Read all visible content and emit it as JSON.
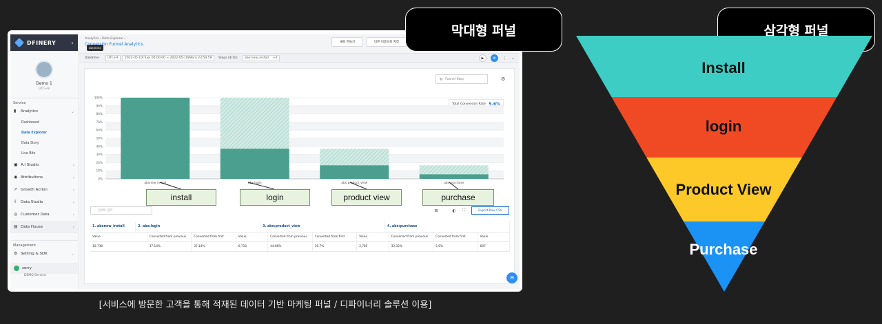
{
  "left_pill": "막대형 퍼널",
  "right_pill": "삼각형 퍼널",
  "caption": "[서비스에 방문한 고객을 통해 적재된 데이터 기반 마케팅 퍼널 / 디파이너리 솔루션 이용]",
  "app": {
    "brand": "DFINERY",
    "user_name": "Demo 1",
    "user_sub": "UTC+9",
    "sidebar": {
      "service_label": "Service",
      "analytics": "Analytics",
      "sub_items": [
        "Dashboard",
        "Data Explorer",
        "Data Story",
        "Live Bits"
      ],
      "items": [
        "A.I Studio",
        "Attributions",
        "Growth Action",
        "Data Studio",
        "Customer Data",
        "Data House"
      ],
      "management_label": "Management",
      "setting": "Setting & SDK",
      "workspace": "zerry",
      "workspace_sub": "DEMO Service"
    },
    "breadcrumb": "Analytics  ›  Data Explorer  ›",
    "page_title": "Conversion Funnel Analytics",
    "tooltip": "Datetime",
    "btn_new": "새로 만들기",
    "btn_save_as": "다른 이름으로 저장",
    "filter": {
      "datetime_label": "Datetime",
      "tz": "UTC+9",
      "range": "2022-05-10(Tue) 00:00:00 ~ 2022-05-10(Mon) 23:59:59",
      "steps_label": "Steps (4/10)",
      "step_value": "abx:new_install",
      "step_more": "+3"
    },
    "funnel_step_select": "Funnel Step",
    "tcr_label": "Total Conversion Rate",
    "tcr_value": "5.6%",
    "search_placeholder": "검색어 입력",
    "export_label": "Export Raw CSV",
    "table": {
      "steps": [
        "1. abxnew_install",
        "2. abx:login",
        "3. abx:product_view",
        "4. abx:purchase"
      ],
      "subheads_first": [
        "Value"
      ],
      "subheads": [
        "Value",
        "Converted from previous",
        "Converted from first"
      ],
      "values": [
        [
          "10,736"
        ],
        [
          "37.14%",
          "37.14%",
          "6,710"
        ],
        [
          "44.86%",
          "16.7%",
          "2,785"
        ],
        [
          "33.32%",
          "5.6%",
          "607"
        ]
      ]
    }
  },
  "chart_data": {
    "type": "bar",
    "categories": [
      "abxnew_install",
      "abx:login",
      "abx:product_view",
      "abx:purchase"
    ],
    "y_ticks": [
      "0%",
      "10%",
      "20%",
      "30%",
      "40%",
      "50%",
      "60%",
      "70%",
      "80%",
      "90%",
      "100%"
    ],
    "ylim": [
      0,
      100
    ],
    "series": [
      {
        "values": [
          100,
          37.14,
          16.7,
          5.6
        ]
      },
      {
        "values": [
          0,
          62.86,
          20.44,
          11.1
        ]
      }
    ],
    "colors": {
      "solid": "#4a9f8f",
      "hatched": "#b9ddd5"
    }
  },
  "green_labels": [
    "install",
    "login",
    "product view",
    "purchase"
  ],
  "triangle_funnel": {
    "layers": [
      {
        "label": "Install",
        "color": "#3ecdc4",
        "text_color": "#111111"
      },
      {
        "label": "login",
        "color": "#f04a25",
        "text_color": "#111111"
      },
      {
        "label": "Product View",
        "color": "#fdc928",
        "text_color": "#111111"
      },
      {
        "label": "Purchase",
        "color": "#1b93f5",
        "text_color": "#ffffff"
      }
    ]
  }
}
